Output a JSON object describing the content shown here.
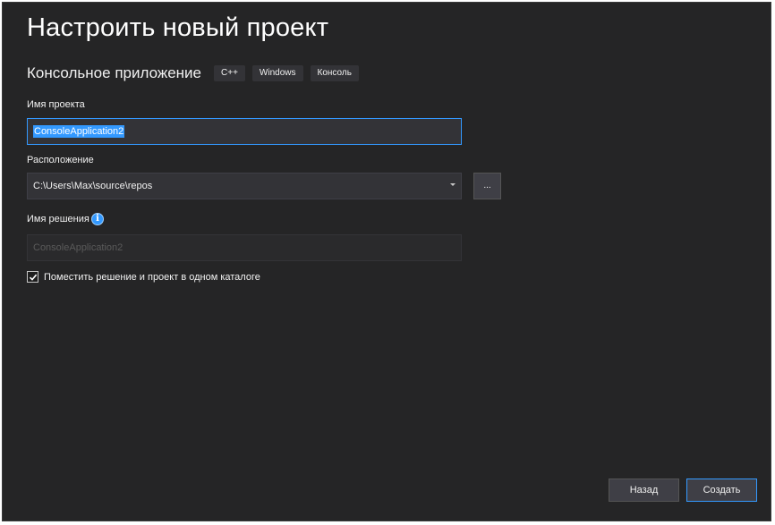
{
  "dialog": {
    "title": "Настроить новый проект",
    "template_name": "Консольное приложение",
    "tags": [
      "C++",
      "Windows",
      "Консоль"
    ]
  },
  "project_name": {
    "label": "Имя проекта",
    "value": "ConsoleApplication2"
  },
  "location": {
    "label": "Расположение",
    "value": "C:\\Users\\Max\\source\\repos",
    "browse_label": "..."
  },
  "solution_name": {
    "label": "Имя решения",
    "info_icon": "i",
    "placeholder": "ConsoleApplication2"
  },
  "same_folder": {
    "label": "Поместить решение и проект в одном каталоге",
    "checked": true
  },
  "buttons": {
    "back_label": "Назад",
    "create_label": "Создать"
  },
  "colors": {
    "background": "#252526",
    "accent": "#3399ff"
  }
}
